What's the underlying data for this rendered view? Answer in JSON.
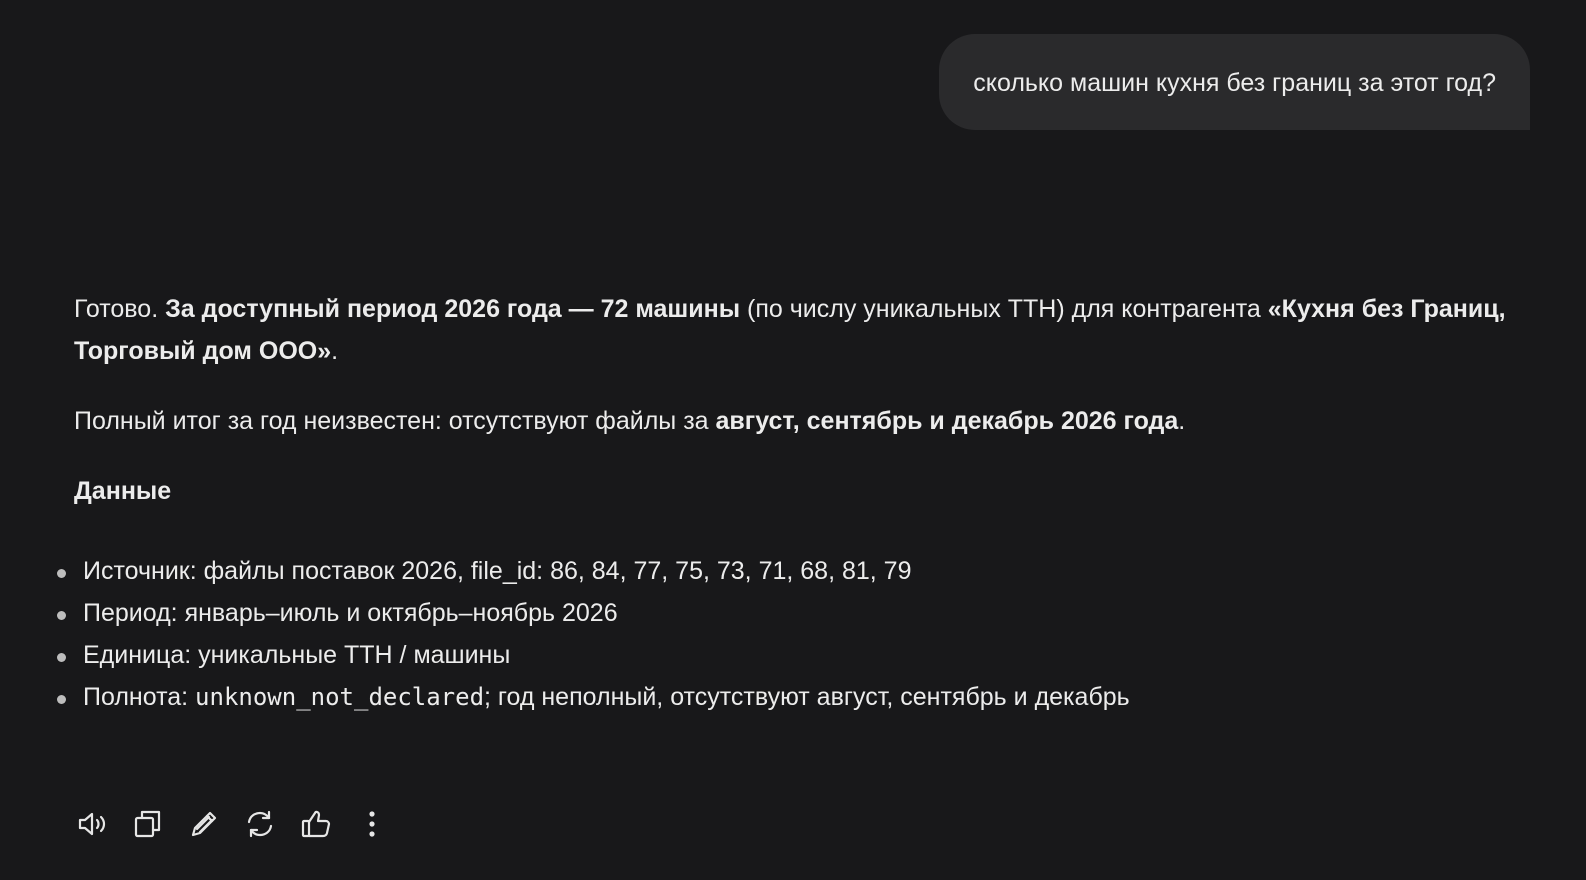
{
  "user_message": {
    "text": "сколько машин кухня без границ за этот год?"
  },
  "assistant_message": {
    "p1": {
      "t1": "Готово. ",
      "b1": "За доступный период 2026 года — 72 машины",
      "t2": " (по числу уникальных ТТН) для контрагента ",
      "b2": "«Кухня без Границ, Торговый дом ООО»",
      "t3": "."
    },
    "p2": {
      "t1": "Полный итог за год неизвестен: отсутствуют файлы за ",
      "b1": "август, сентябрь и декабрь 2026 года",
      "t2": "."
    },
    "heading": "Данные",
    "list": [
      {
        "text": "Источник: файлы поставок 2026, file_id: 86, 84, 77, 75, 73, 71, 68, 81, 79"
      },
      {
        "text": "Период: январь–июль и октябрь–ноябрь 2026"
      },
      {
        "text": "Единица: уникальные ТТН / машины"
      },
      {
        "prefix": "Полнота: ",
        "code": "unknown_not_declared",
        "suffix": "; год неполный, отсутствуют август, сентябрь и декабрь"
      }
    ]
  },
  "toolbar": {
    "icons": [
      "speaker-icon",
      "copy-icon",
      "edit-icon",
      "regenerate-icon",
      "thumbs-up-icon",
      "more-icon"
    ]
  }
}
